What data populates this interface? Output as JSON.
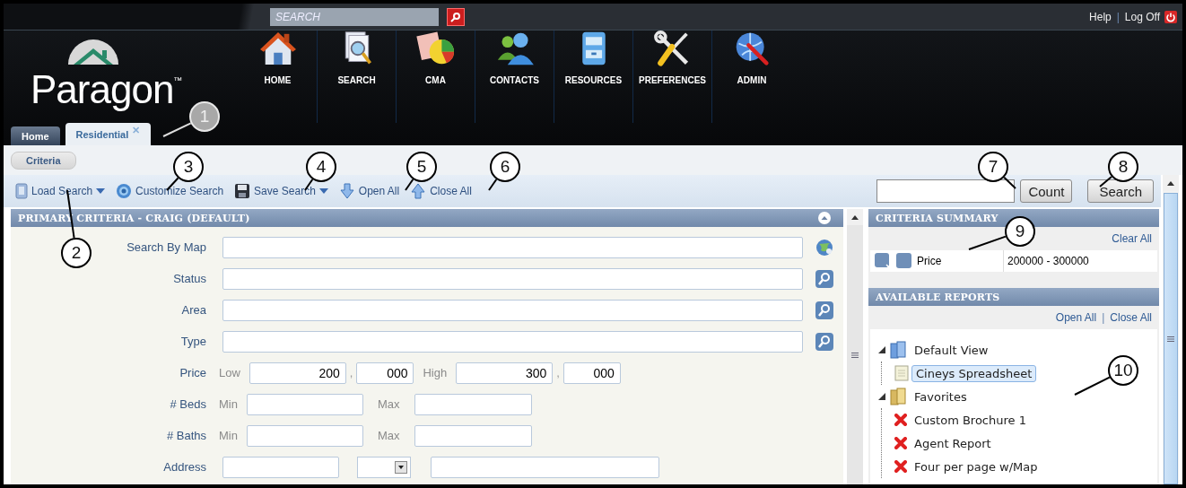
{
  "header": {
    "search": {
      "placeholder": "SEARCH"
    },
    "links": [
      {
        "label": "Help",
        "kind": "plain"
      },
      {
        "label": "Log Off",
        "kind": "logoff"
      }
    ],
    "separator": "|",
    "logo": "Paragon$^{™}$",
    "nav": [
      {
        "label": "HOME",
        "kind": "home"
      },
      {
        "label": "SEARCH",
        "kind": "search"
      },
      {
        "label": "CMA",
        "kind": "cma"
      },
      {
        "label": "CONTACTS",
        "kind": "contacts"
      },
      {
        "label": "RESOURCES",
        "kind": "resources"
      },
      {
        "label": "PREFERENCES",
        "kind": "preferences"
      },
      {
        "label": "ADMIN",
        "kind": "admin"
      }
    ]
  },
  "tabs": [
    {
      "label": "Home",
      "selected": false,
      "closable": false
    },
    {
      "label": "Residential",
      "selected": true,
      "closable": true,
      "close": "✕"
    }
  ],
  "subtab": "Criteria",
  "toolbar": {
    "items": [
      {
        "label": "Load Search",
        "kind": "load",
        "dropdown": true
      },
      {
        "label": "Customize Search",
        "kind": "customize",
        "dropdown": false
      },
      {
        "label": "Save Search",
        "kind": "save",
        "dropdown": true
      },
      {
        "label": "Open All",
        "kind": "open",
        "dropdown": false
      },
      {
        "label": "Close All",
        "kind": "close",
        "dropdown": false
      }
    ],
    "count_button": "Count",
    "search_button": "Search"
  },
  "criteria": {
    "title": "PRIMARY CRITERIA - CRAIG (DEFAULT)",
    "fields": [
      {
        "label": "Search By Map",
        "kind": "map"
      },
      {
        "label": "Status",
        "kind": "lookup"
      },
      {
        "label": "Area",
        "kind": "lookup"
      },
      {
        "label": "Type",
        "kind": "lookup"
      },
      {
        "label": "Price",
        "kind": "price",
        "low_label": "Low",
        "low": {
          "whole": "200",
          "sep": ",",
          "thousands": "000"
        },
        "high_label": "High",
        "high": {
          "whole": "300",
          "sep": ",",
          "thousands": "000"
        }
      },
      {
        "label": "# Beds",
        "kind": "range",
        "min_label": "Min",
        "max_label": "Max"
      },
      {
        "label": "# Baths",
        "kind": "range",
        "min_label": "Min",
        "max_label": "Max"
      },
      {
        "label": "Address",
        "kind": "address"
      }
    ]
  },
  "summary": {
    "title": "CRITERIA SUMMARY",
    "clear": "Clear All",
    "rows": [
      {
        "name": "Price",
        "value": "200000 - 300000"
      }
    ]
  },
  "reports": {
    "title": "AVAILABLE REPORTS",
    "open_all": "Open All",
    "separator": "|",
    "close_all": "Close All",
    "tree": [
      {
        "label": "Default View",
        "kind": "view",
        "expanded": true,
        "selected": false,
        "children": [
          {
            "label": "Cineys Spreadsheet",
            "kind": "sheet",
            "selected": true
          }
        ]
      },
      {
        "label": "Favorites",
        "kind": "folder",
        "expanded": true,
        "selected": false,
        "children": [
          {
            "label": "Custom Brochure 1",
            "kind": "report",
            "selected": false
          },
          {
            "label": "Agent Report",
            "kind": "report",
            "selected": false
          },
          {
            "label": "Four per page w/Map",
            "kind": "report",
            "selected": false
          }
        ]
      }
    ]
  },
  "callouts": [
    {
      "number": "1"
    },
    {
      "number": "2"
    },
    {
      "number": "3"
    },
    {
      "number": "4"
    },
    {
      "number": "5"
    },
    {
      "number": "6"
    },
    {
      "number": "7"
    },
    {
      "number": "8"
    },
    {
      "number": "9"
    },
    {
      "number": "10"
    }
  ]
}
